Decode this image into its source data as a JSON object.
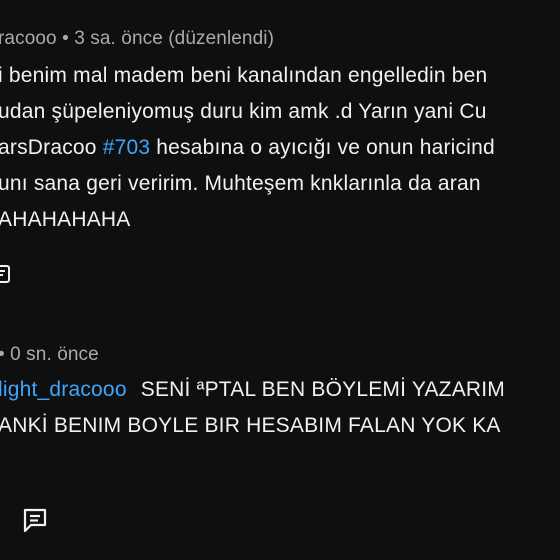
{
  "comment1": {
    "meta": "racooo • 3 sa. önce (düzenlendi)",
    "lines": [
      "i benim mal madem beni kanalından engelledin ben",
      "udan şüpeleniyomuş duru kim amk .d Yarın yani Cu",
      "arsDracoo",
      "hesabına o ayıcığı ve onun haricind",
      "unı sana geri veririm. Muhteşem knklarınla da aran",
      "AHAHAHAHA"
    ],
    "hashtag": "#703"
  },
  "comment2": {
    "meta": "• 0 sn. önce",
    "mention": "light_dracooo",
    "lines": [
      "SENİ ªPTAL BEN BÖYLEMİ YAZARIM",
      "ANKİ BENIM BOYLE BIR HESABIM FALAN YOK KA"
    ]
  },
  "icons": {
    "top_left": "comment-icon",
    "bottom": "comment-reply-icon"
  }
}
